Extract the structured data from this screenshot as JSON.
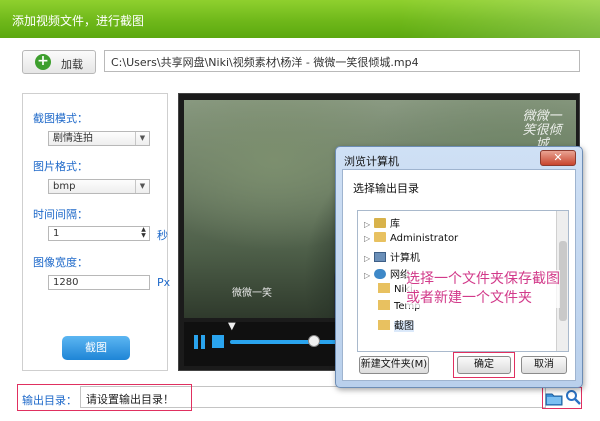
{
  "window": {
    "title": "添加视频文件，进行截图"
  },
  "toolbar": {
    "load_label": "加载",
    "file_path": "C:\\Users\\共享网盘\\Niki\\视频素材\\杨洋 - 微微一笑很倾城.mp4"
  },
  "settings": {
    "mode_label": "截图模式：",
    "mode_value": "剧情连拍",
    "format_label": "图片格式：",
    "format_value": "bmp",
    "interval_label": "时间间隔：",
    "interval_value": "1",
    "interval_unit": "秒",
    "width_label": "图像宽度：",
    "width_value": "1280",
    "width_unit": "Px",
    "capture_label": "截图"
  },
  "video": {
    "watermark": "微微一笑很倾城",
    "subtitle": "微微一笑",
    "progress": 0.57
  },
  "output": {
    "label": "输出目录：",
    "value": "请设置输出目录！"
  },
  "dialog": {
    "title": "浏览计算机",
    "close_glyph": "✕",
    "prompt": "选择输出目录",
    "tree": [
      {
        "label": "库",
        "icon": "library-icon"
      },
      {
        "label": "Administrator",
        "icon": "user-folder-icon"
      },
      {
        "label": "计算机",
        "icon": "computer-icon"
      },
      {
        "label": "网络",
        "icon": "network-icon"
      },
      {
        "label": "Niki",
        "icon": "folder-icon"
      },
      {
        "label": "Temp",
        "icon": "folder-icon"
      },
      {
        "label": "截图",
        "icon": "folder-icon"
      }
    ],
    "new_folder_label": "新建文件夹(M)",
    "ok_label": "确定",
    "cancel_label": "取消"
  },
  "annotation": {
    "line1": "选择一个文件夹保存截图",
    "line2": "或者新建一个文件夹"
  },
  "colors": {
    "titlebar": "#6fb81a",
    "accent_blue": "#1d68c9",
    "highlight_red": "#e03060",
    "annotation": "#d23a8a"
  }
}
